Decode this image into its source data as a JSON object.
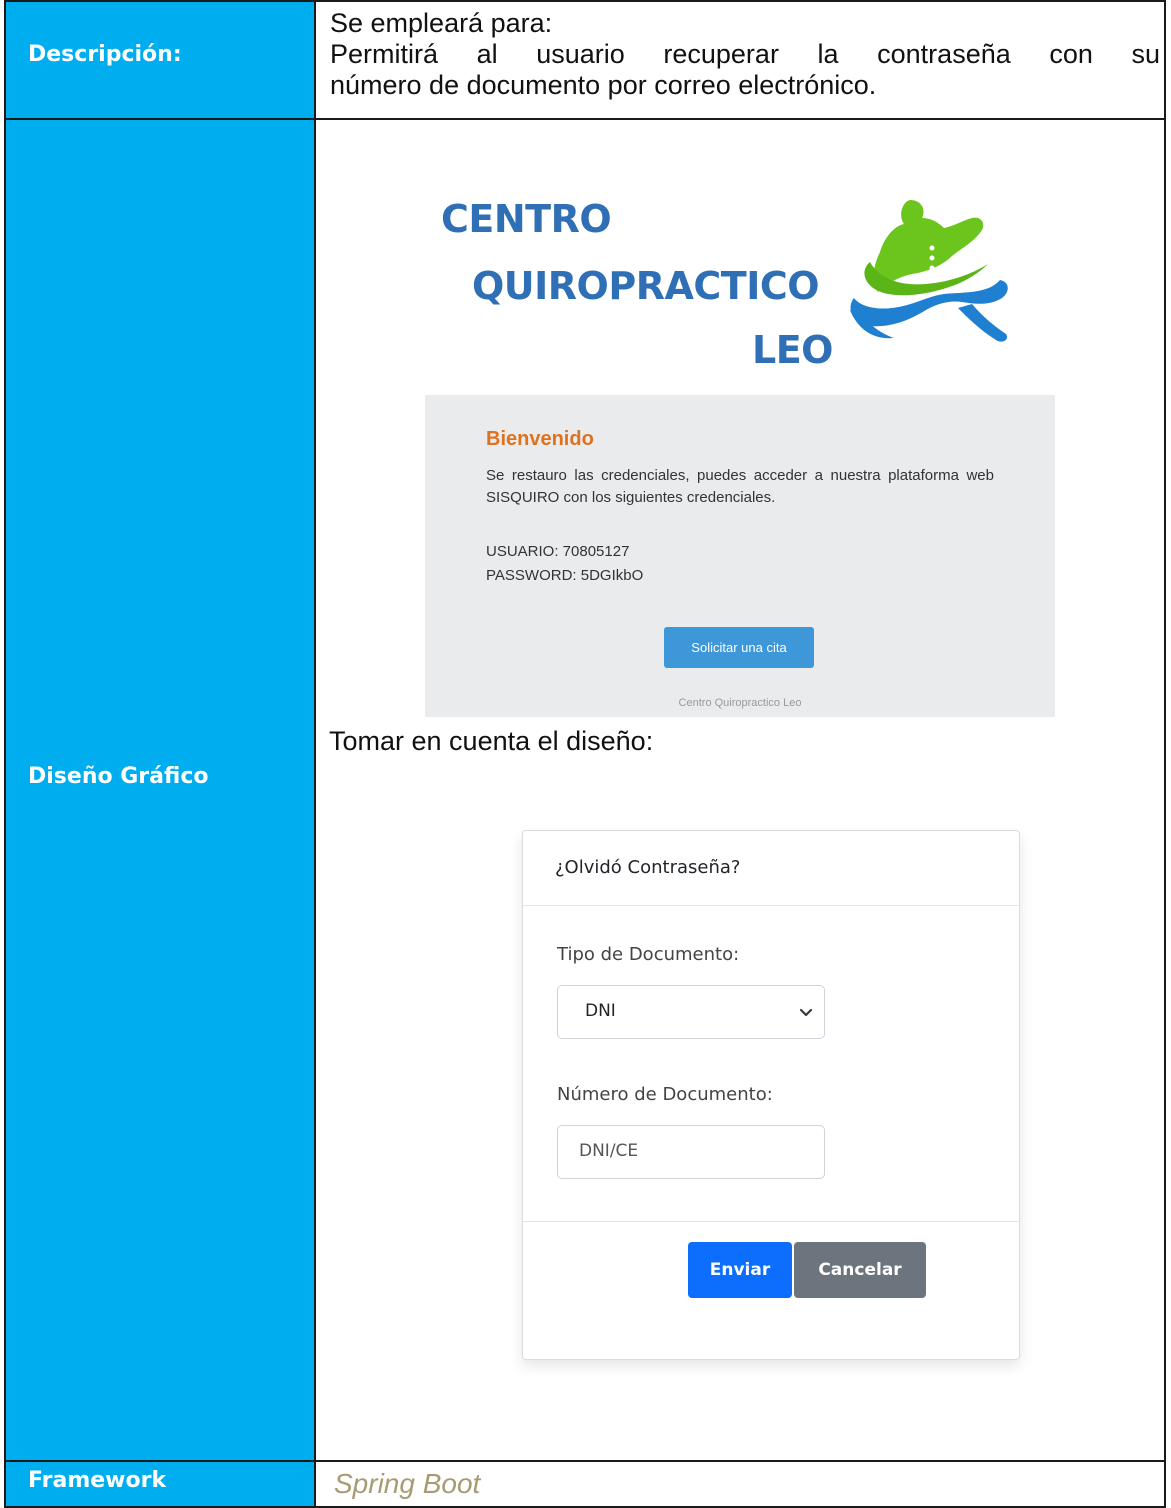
{
  "rows": {
    "description": {
      "label": "Descripción:",
      "line1": "Se empleará para:",
      "line2": "Permitirá al usuario recuperar la contraseña con su",
      "line3": "número de documento por correo electrónico."
    },
    "design": {
      "label": "Diseño Gráfico",
      "note": "Tomar en cuenta el diseño:"
    },
    "framework": {
      "label": "Framework",
      "value": "Spring Boot"
    }
  },
  "logo": {
    "line1": "CENTRO",
    "line2": "QUIROPRACTICO",
    "line3": "LEO"
  },
  "email": {
    "title": "Bienvenido",
    "body": "Se restauro las credenciales, puedes acceder a nuestra plataforma web SISQUIRO con los siguientes credenciales.",
    "user": "USUARIO: 70805127",
    "password": "PASSWORD: 5DGIkbO",
    "button": "Solicitar una cita",
    "footer": "Centro Quiropractico Leo"
  },
  "form": {
    "title": "¿Olvidó Contraseña?",
    "doc_type_label": "Tipo de Documento:",
    "doc_type_value": "DNI",
    "doc_number_label": "Número de Documento:",
    "doc_number_placeholder": "DNI/CE",
    "submit": "Enviar",
    "cancel": "Cancelar"
  },
  "colors": {
    "label_bg": "#00adef",
    "logo_blue": "#2f6fb5",
    "logo_green": "#6cc51c",
    "email_title": "#e0721f",
    "primary": "#0d6efd",
    "secondary": "#6c757d"
  }
}
